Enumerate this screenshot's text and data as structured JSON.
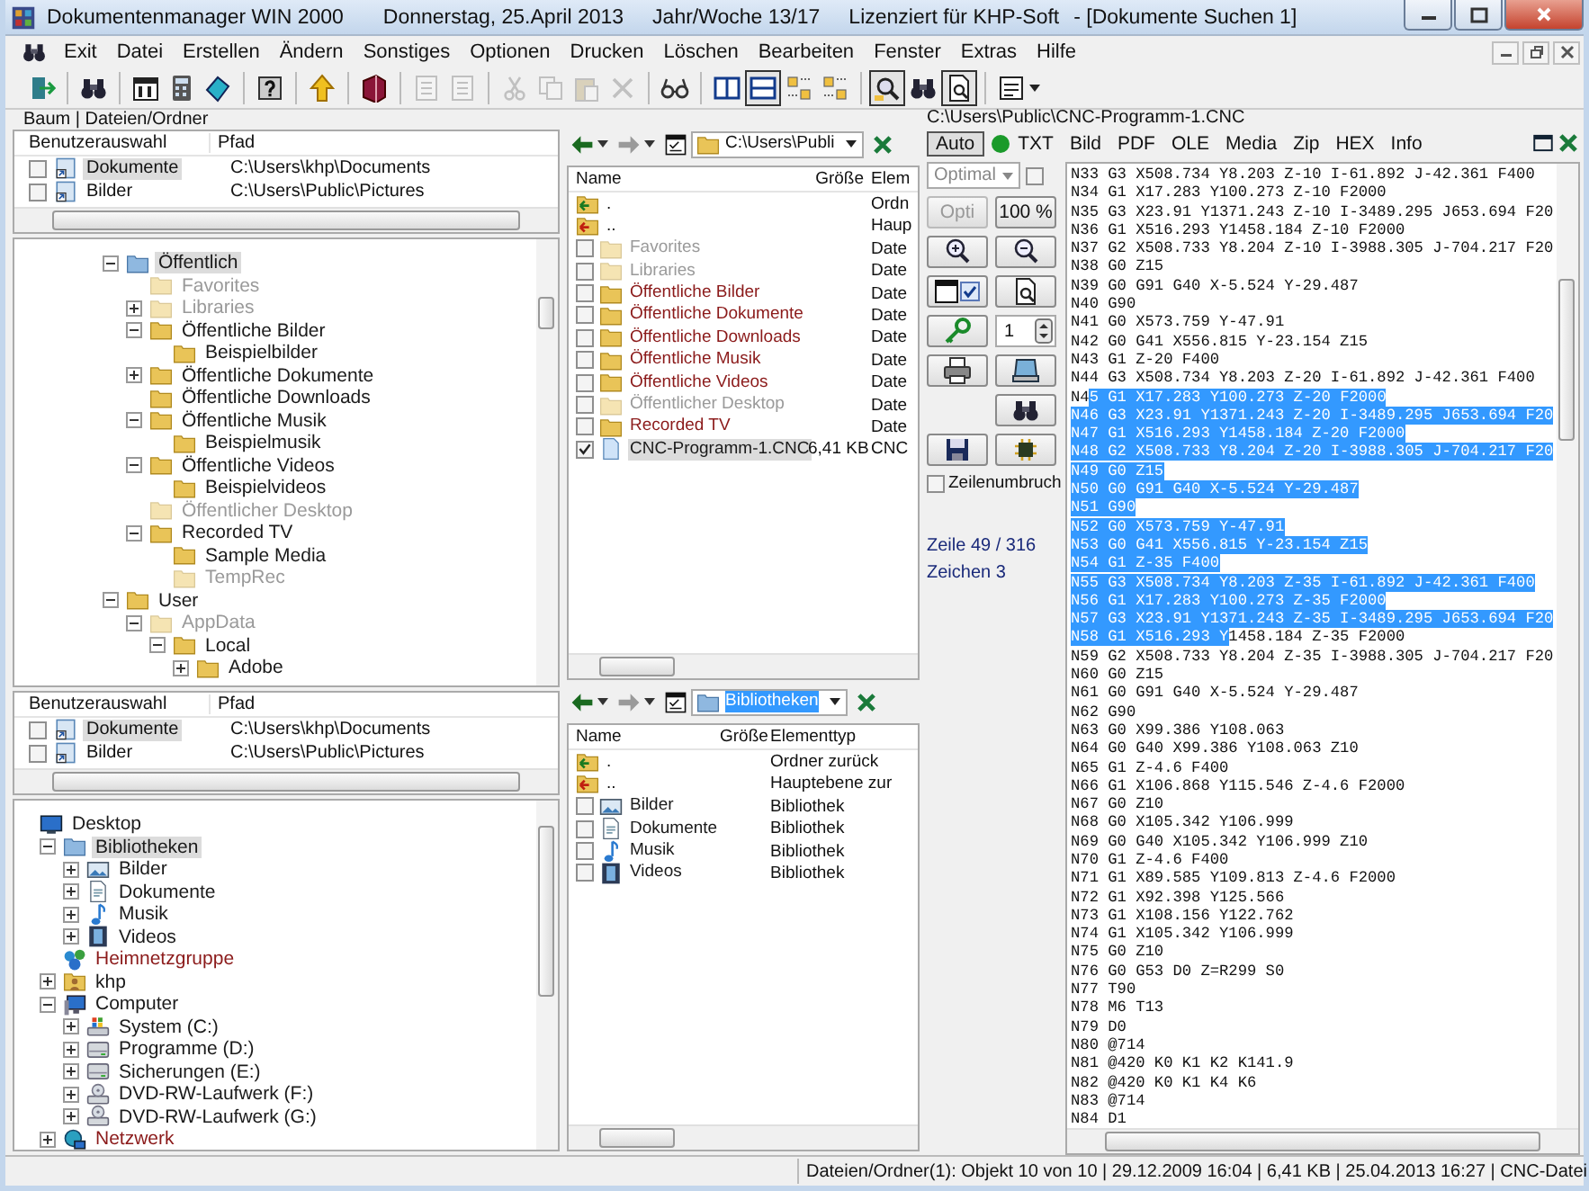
{
  "window": {
    "title": "Dokumentenmanager WIN 2000",
    "date": "Donnerstag, 25.April 2013",
    "week": "Jahr/Woche 13/17",
    "license": "Lizenziert für KHP-Soft",
    "document": "- [Dokumente Suchen 1]"
  },
  "menu": [
    "Exit",
    "Datei",
    "Erstellen",
    "Ändern",
    "Sonstiges",
    "Optionen",
    "Drucken",
    "Löschen",
    "Bearbeiten",
    "Fenster",
    "Extras",
    "Hilfe"
  ],
  "toolbar": [
    [
      {
        "kind": "exit",
        "disabled": false,
        "pressed": false
      }
    ],
    [
      {
        "kind": "binoculars",
        "disabled": false,
        "pressed": false
      }
    ],
    [
      {
        "kind": "calendar",
        "disabled": false,
        "pressed": false
      },
      {
        "kind": "calculator",
        "disabled": false,
        "pressed": false
      },
      {
        "kind": "eraser",
        "disabled": false,
        "pressed": false
      }
    ],
    [
      {
        "kind": "help",
        "disabled": false,
        "pressed": false
      }
    ],
    [
      {
        "kind": "upload",
        "disabled": false,
        "pressed": false
      }
    ],
    [
      {
        "kind": "book",
        "disabled": false,
        "pressed": false
      }
    ],
    [
      {
        "kind": "list",
        "disabled": true,
        "pressed": false
      },
      {
        "kind": "list",
        "disabled": true,
        "pressed": false
      }
    ],
    [
      {
        "kind": "scissors",
        "disabled": true,
        "pressed": false
      },
      {
        "kind": "copy",
        "disabled": true,
        "pressed": false
      },
      {
        "kind": "paste",
        "disabled": true,
        "pressed": false
      },
      {
        "kind": "delete",
        "disabled": true,
        "pressed": false
      }
    ],
    [
      {
        "kind": "glasses",
        "disabled": false,
        "pressed": false
      }
    ],
    [
      {
        "kind": "columns",
        "disabled": false,
        "pressed": false
      },
      {
        "kind": "rows",
        "disabled": false,
        "pressed": true
      },
      {
        "kind": "tiles",
        "disabled": false,
        "pressed": false
      },
      {
        "kind": "tiles",
        "disabled": false,
        "pressed": false
      }
    ],
    [
      {
        "kind": "search",
        "disabled": false,
        "pressed": true
      },
      {
        "kind": "binoculars",
        "disabled": false,
        "pressed": false
      },
      {
        "kind": "preview",
        "disabled": false,
        "pressed": true
      }
    ],
    [
      {
        "kind": "page",
        "disabled": false,
        "pressed": false
      }
    ]
  ],
  "left": {
    "caption": "Baum | Dateien/Ordner",
    "panes": [
      {
        "columns": [
          "Benutzerauswahl",
          "Pfad"
        ],
        "rows": [
          {
            "name": "Dokumente",
            "path": "C:\\Users\\khp\\Documents",
            "checked": false,
            "selected": true
          },
          {
            "name": "Bilder",
            "path": "C:\\Users\\Public\\Pictures",
            "checked": false,
            "selected": false
          }
        ],
        "tree": [
          {
            "label": "Öffentlich",
            "kind": "library",
            "expandable": true,
            "expanded": true,
            "hidden": false,
            "color": "#1a1a1a",
            "selected": true,
            "children": [
              {
                "label": "Favorites",
                "kind": "folder",
                "expandable": false,
                "hidden": true,
                "color": "#9a9a9a",
                "selected": false
              },
              {
                "label": "Libraries",
                "kind": "folder",
                "expandable": true,
                "expanded": false,
                "hidden": true,
                "color": "#9a9a9a",
                "selected": false
              },
              {
                "label": "Öffentliche Bilder",
                "kind": "folder",
                "expandable": true,
                "expanded": true,
                "hidden": false,
                "color": "#1a1a1a",
                "selected": false,
                "children": [
                  {
                    "label": "Beispielbilder",
                    "kind": "folder",
                    "expandable": false,
                    "hidden": false,
                    "color": "#1a1a1a",
                    "selected": false
                  }
                ]
              },
              {
                "label": "Öffentliche Dokumente",
                "kind": "folder",
                "expandable": true,
                "expanded": false,
                "hidden": false,
                "color": "#1a1a1a",
                "selected": false
              },
              {
                "label": "Öffentliche Downloads",
                "kind": "folder",
                "expandable": false,
                "hidden": false,
                "color": "#1a1a1a",
                "selected": false
              },
              {
                "label": "Öffentliche Musik",
                "kind": "folder",
                "expandable": true,
                "expanded": true,
                "hidden": false,
                "color": "#1a1a1a",
                "selected": false,
                "children": [
                  {
                    "label": "Beispielmusik",
                    "kind": "folder",
                    "expandable": false,
                    "hidden": false,
                    "color": "#1a1a1a",
                    "selected": false
                  }
                ]
              },
              {
                "label": "Öffentliche Videos",
                "kind": "folder",
                "expandable": true,
                "expanded": true,
                "hidden": false,
                "color": "#1a1a1a",
                "selected": false,
                "children": [
                  {
                    "label": "Beispielvideos",
                    "kind": "folder",
                    "expandable": false,
                    "hidden": false,
                    "color": "#1a1a1a",
                    "selected": false
                  }
                ]
              },
              {
                "label": "Öffentlicher Desktop",
                "kind": "folder",
                "expandable": false,
                "hidden": true,
                "color": "#9a9a9a",
                "selected": false
              },
              {
                "label": "Recorded TV",
                "kind": "folder",
                "expandable": true,
                "expanded": true,
                "hidden": false,
                "color": "#1a1a1a",
                "selected": false,
                "children": [
                  {
                    "label": "Sample Media",
                    "kind": "folder",
                    "expandable": false,
                    "hidden": false,
                    "color": "#1a1a1a",
                    "selected": false
                  },
                  {
                    "label": "TempRec",
                    "kind": "folder",
                    "expandable": false,
                    "hidden": true,
                    "color": "#9a9a9a",
                    "selected": false
                  }
                ]
              }
            ]
          },
          {
            "label": "User",
            "kind": "folder",
            "expandable": true,
            "expanded": true,
            "hidden": false,
            "color": "#1a1a1a",
            "selected": false,
            "children": [
              {
                "label": "AppData",
                "kind": "folder",
                "expandable": true,
                "expanded": true,
                "hidden": true,
                "color": "#9a9a9a",
                "selected": false,
                "children": [
                  {
                    "label": "Local",
                    "kind": "folder",
                    "expandable": true,
                    "expanded": true,
                    "hidden": false,
                    "color": "#1a1a1a",
                    "selected": false,
                    "children": [
                      {
                        "label": "Adobe",
                        "kind": "folder",
                        "expandable": true,
                        "expanded": false,
                        "hidden": false,
                        "color": "#1a1a1a",
                        "selected": false
                      }
                    ]
                  }
                ]
              }
            ]
          }
        ]
      },
      {
        "columns": [
          "Benutzerauswahl",
          "Pfad"
        ],
        "rows": [
          {
            "name": "Dokumente",
            "path": "C:\\Users\\khp\\Documents",
            "checked": false,
            "selected": true
          },
          {
            "name": "Bilder",
            "path": "C:\\Users\\Public\\Pictures",
            "checked": false,
            "selected": false
          }
        ],
        "tree": [
          {
            "label": "Desktop",
            "kind": "desktop",
            "expandable": false,
            "hidden": false,
            "color": "#1a1a1a",
            "selected": false,
            "children": [
              {
                "label": "Bibliotheken",
                "kind": "library",
                "expandable": true,
                "expanded": true,
                "hidden": false,
                "color": "#1a1a1a",
                "selected": true,
                "children": [
                  {
                    "label": "Bilder",
                    "kind": "image",
                    "expandable": true,
                    "expanded": false,
                    "hidden": false,
                    "color": "#1a1a1a",
                    "selected": false
                  },
                  {
                    "label": "Dokumente",
                    "kind": "document",
                    "expandable": true,
                    "expanded": false,
                    "hidden": false,
                    "color": "#1a1a1a",
                    "selected": false
                  },
                  {
                    "label": "Musik",
                    "kind": "music",
                    "expandable": true,
                    "expanded": false,
                    "hidden": false,
                    "color": "#1a1a1a",
                    "selected": false
                  },
                  {
                    "label": "Videos",
                    "kind": "film",
                    "expandable": true,
                    "expanded": false,
                    "hidden": false,
                    "color": "#1a1a1a",
                    "selected": false
                  }
                ]
              },
              {
                "label": "Heimnetzgruppe",
                "kind": "homegroup",
                "expandable": false,
                "hidden": false,
                "color": "#8b1a1a",
                "selected": false
              },
              {
                "label": "khp",
                "kind": "user",
                "expandable": true,
                "expanded": false,
                "hidden": false,
                "color": "#1a1a1a",
                "selected": false
              },
              {
                "label": "Computer",
                "kind": "computer",
                "expandable": true,
                "expanded": true,
                "hidden": false,
                "color": "#1a1a1a",
                "selected": false,
                "children": [
                  {
                    "label": "System (C:)",
                    "kind": "drive-system",
                    "expandable": true,
                    "expanded": false,
                    "hidden": false,
                    "color": "#1a1a1a",
                    "selected": false
                  },
                  {
                    "label": "Programme (D:)",
                    "kind": "drive",
                    "expandable": true,
                    "expanded": false,
                    "hidden": false,
                    "color": "#1a1a1a",
                    "selected": false
                  },
                  {
                    "label": "Sicherungen (E:)",
                    "kind": "drive",
                    "expandable": true,
                    "expanded": false,
                    "hidden": false,
                    "color": "#1a1a1a",
                    "selected": false
                  },
                  {
                    "label": "DVD-RW-Laufwerk (F:)",
                    "kind": "dvd",
                    "expandable": true,
                    "expanded": false,
                    "hidden": false,
                    "color": "#1a1a1a",
                    "selected": false
                  },
                  {
                    "label": "DVD-RW-Laufwerk (G:)",
                    "kind": "dvd",
                    "expandable": true,
                    "expanded": false,
                    "hidden": false,
                    "color": "#1a1a1a",
                    "selected": false
                  }
                ]
              },
              {
                "label": "Netzwerk",
                "kind": "network",
                "expandable": true,
                "expanded": false,
                "hidden": false,
                "color": "#8b1a1a",
                "selected": false
              }
            ]
          }
        ]
      }
    ]
  },
  "middle": {
    "panes": [
      {
        "path": "C:\\Users\\Publi",
        "kind": "folder",
        "path_selected": false,
        "columns": [
          "Name",
          "Größe",
          "Elem"
        ],
        "rows": [
          {
            "kind": "parent-back",
            "name": ".",
            "hidden": false,
            "selected": false,
            "type": "Ordn"
          },
          {
            "kind": "parent-up",
            "name": "..",
            "hidden": false,
            "selected": false,
            "type": "Haup"
          },
          {
            "kind": "folder",
            "name": "Favorites",
            "hidden": true,
            "color": "#9a9a9a",
            "checked": false,
            "selected": false,
            "type": "Date"
          },
          {
            "kind": "folder",
            "name": "Libraries",
            "hidden": true,
            "color": "#9a9a9a",
            "checked": false,
            "selected": false,
            "type": "Date"
          },
          {
            "kind": "folder",
            "name": "Öffentliche Bilder",
            "hidden": false,
            "color": "#8b1a1a",
            "checked": false,
            "selected": false,
            "type": "Date"
          },
          {
            "kind": "folder",
            "name": "Öffentliche Dokumente",
            "hidden": false,
            "color": "#8b1a1a",
            "checked": false,
            "selected": false,
            "type": "Date"
          },
          {
            "kind": "folder",
            "name": "Öffentliche Downloads",
            "hidden": false,
            "color": "#8b1a1a",
            "checked": false,
            "selected": false,
            "type": "Date"
          },
          {
            "kind": "folder",
            "name": "Öffentliche Musik",
            "hidden": false,
            "color": "#8b1a1a",
            "checked": false,
            "selected": false,
            "type": "Date"
          },
          {
            "kind": "folder",
            "name": "Öffentliche Videos",
            "hidden": false,
            "color": "#8b1a1a",
            "checked": false,
            "selected": false,
            "type": "Date"
          },
          {
            "kind": "folder",
            "name": "Öffentlicher Desktop",
            "hidden": true,
            "color": "#9a9a9a",
            "checked": false,
            "selected": false,
            "type": "Date"
          },
          {
            "kind": "folder",
            "name": "Recorded TV",
            "hidden": false,
            "color": "#8b1a1a",
            "checked": false,
            "selected": false,
            "type": "Date"
          },
          {
            "kind": "file",
            "name": "CNC-Programm-1.CNC",
            "hidden": false,
            "color": "#1a1a1a",
            "checked": true,
            "selected": true,
            "size": "6,41 KB",
            "type": "CNC"
          }
        ]
      },
      {
        "path": "Bibliotheken",
        "kind": "library",
        "path_selected": true,
        "columns": [
          "Name",
          "Größe",
          "Elementtyp"
        ],
        "rows": [
          {
            "kind": "parent-back",
            "name": ".",
            "hidden": false,
            "selected": false,
            "type": "Ordner zurück"
          },
          {
            "kind": "parent-up",
            "name": "..",
            "hidden": false,
            "selected": false,
            "type": "Hauptebene zur"
          },
          {
            "kind": "image",
            "name": "Bilder",
            "hidden": false,
            "color": "#1a1a1a",
            "checked": false,
            "selected": false,
            "type": "Bibliothek"
          },
          {
            "kind": "document",
            "name": "Dokumente",
            "hidden": false,
            "color": "#1a1a1a",
            "checked": false,
            "selected": false,
            "type": "Bibliothek"
          },
          {
            "kind": "music",
            "name": "Musik",
            "hidden": false,
            "color": "#1a1a1a",
            "checked": false,
            "selected": false,
            "type": "Bibliothek"
          },
          {
            "kind": "film",
            "name": "Videos",
            "hidden": false,
            "color": "#1a1a1a",
            "checked": false,
            "selected": false,
            "type": "Bibliothek"
          }
        ]
      }
    ]
  },
  "viewer": {
    "path": "C:\\Users\\Public\\CNC-Programm-1.CNC",
    "auto": {
      "label": "Auto",
      "pressed": true
    },
    "tabs": [
      {
        "label": "TXT",
        "selected": true
      },
      {
        "label": "Bild",
        "selected": false
      },
      {
        "label": "PDF",
        "selected": false
      },
      {
        "label": "OLE",
        "selected": false
      },
      {
        "label": "Media",
        "selected": false
      },
      {
        "label": "Zip",
        "selected": false
      },
      {
        "label": "HEX",
        "selected": false
      },
      {
        "label": "Info",
        "selected": false
      }
    ],
    "zoom_mode": "Optimal",
    "zoom_lock": false,
    "opti": {
      "label": "Opti",
      "disabled": true
    },
    "zoom_value": "100 %",
    "toggle_checked": true,
    "page": "1",
    "wrap": {
      "label": "Zeilenumbruch",
      "checked": false
    },
    "line_info": "Zeile 49 / 316",
    "char_info": "Zeichen 3",
    "lines": [
      {
        "text": "N33 G3 X508.734 Y8.203 Z-10 I-61.892 J-42.361 F400",
        "selected": false
      },
      {
        "text": "N34 G1 X17.283 Y100.273 Z-10 F2000",
        "selected": false
      },
      {
        "text": "N35 G3 X23.91 Y1371.243 Z-10 I-3489.295 J653.694 F20",
        "selected": false
      },
      {
        "text": "N36 G1 X516.293 Y1458.184 Z-10 F2000",
        "selected": false
      },
      {
        "text": "N37 G2 X508.733 Y8.204 Z-10 I-3988.305 J-704.217 F20",
        "selected": false
      },
      {
        "text": "N38 G0 Z15",
        "selected": false
      },
      {
        "text": "N39 G0 G91 G40 X-5.524 Y-29.487",
        "selected": false
      },
      {
        "text": "N40 G90",
        "selected": false
      },
      {
        "text": "N41 G0 X573.759 Y-47.91",
        "selected": false
      },
      {
        "text": "N42 G0 G41 X556.815 Y-23.154 Z15",
        "selected": false
      },
      {
        "text": "N43 G1 Z-20 F400",
        "selected": false
      },
      {
        "text": "N44 G3 X508.734 Y8.203 Z-20 I-61.892 J-42.361 F400",
        "selected": false
      },
      {
        "parts": [
          {
            "text": "N4",
            "selected": false
          },
          {
            "text": "5 G1 X17.283 Y100.273 Z-20 F2000",
            "selected": true
          }
        ]
      },
      {
        "text": "N46 G3 X23.91 Y1371.243 Z-20 I-3489.295 J653.694 F20",
        "selected": true
      },
      {
        "text": "N47 G1 X516.293 Y1458.184 Z-20 F2000",
        "selected": true
      },
      {
        "text": "N48 G2 X508.733 Y8.204 Z-20 I-3988.305 J-704.217 F20",
        "selected": true
      },
      {
        "text": "N49 G0 Z15",
        "selected": true
      },
      {
        "text": "N50 G0 G91 G40 X-5.524 Y-29.487",
        "selected": true
      },
      {
        "text": "N51 G90",
        "selected": true
      },
      {
        "text": "N52 G0 X573.759 Y-47.91",
        "selected": true
      },
      {
        "text": "N53 G0 G41 X556.815 Y-23.154 Z15",
        "selected": true
      },
      {
        "text": "N54 G1 Z-35 F400",
        "selected": true
      },
      {
        "text": "N55 G3 X508.734 Y8.203 Z-35 I-61.892 J-42.361 F400",
        "selected": true
      },
      {
        "text": "N56 G1 X17.283 Y100.273 Z-35 F2000",
        "selected": true
      },
      {
        "text": "N57 G3 X23.91 Y1371.243 Z-35 I-3489.295 J653.694 F20",
        "selected": true
      },
      {
        "parts": [
          {
            "text": "N58 G1 X516.293 Y",
            "selected": true
          },
          {
            "text": "1458.184 Z-35 F2000",
            "selected": false
          }
        ]
      },
      {
        "text": "N59 G2 X508.733 Y8.204 Z-35 I-3988.305 J-704.217 F20",
        "selected": false
      },
      {
        "text": "N60 G0 Z15",
        "selected": false
      },
      {
        "text": "N61 G0 G91 G40 X-5.524 Y-29.487",
        "selected": false
      },
      {
        "text": "N62 G90",
        "selected": false
      },
      {
        "text": "N63 G0 X99.386 Y108.063",
        "selected": false
      },
      {
        "text": "N64 G0 G40 X99.386 Y108.063 Z10",
        "selected": false
      },
      {
        "text": "N65 G1 Z-4.6 F400",
        "selected": false
      },
      {
        "text": "N66 G1 X106.868 Y115.546 Z-4.6 F2000",
        "selected": false
      },
      {
        "text": "N67 G0 Z10",
        "selected": false
      },
      {
        "text": "N68 G0 X105.342 Y106.999",
        "selected": false
      },
      {
        "text": "N69 G0 G40 X105.342 Y106.999 Z10",
        "selected": false
      },
      {
        "text": "N70 G1 Z-4.6 F400",
        "selected": false
      },
      {
        "text": "N71 G1 X89.585 Y109.813 Z-4.6 F2000",
        "selected": false
      },
      {
        "text": "N72 G1 X92.398 Y125.566",
        "selected": false
      },
      {
        "text": "N73 G1 X108.156 Y122.762",
        "selected": false
      },
      {
        "text": "N74 G1 X105.342 Y106.999",
        "selected": false
      },
      {
        "text": "N75 G0 Z10",
        "selected": false
      },
      {
        "text": "N76 G0 G53 D0 Z=R299 S0",
        "selected": false
      },
      {
        "text": "N77 T90",
        "selected": false
      },
      {
        "text": "N78 M6 T13",
        "selected": false
      },
      {
        "text": "N79 D0",
        "selected": false
      },
      {
        "text": "N80 @714",
        "selected": false
      },
      {
        "text": "N81 @420 K0 K1 K2 K141.9",
        "selected": false
      },
      {
        "text": "N82 @420 K0 K1 K4 K6",
        "selected": false
      },
      {
        "text": "N83 @714",
        "selected": false
      },
      {
        "text": "N84 D1",
        "selected": false
      }
    ]
  },
  "status_bar": "Dateien/Ordner(1): Objekt 10 von 10 | 29.12.2009 16:04 | 6,41 KB | 25.04.2013 16:27 | CNC-Datei"
}
